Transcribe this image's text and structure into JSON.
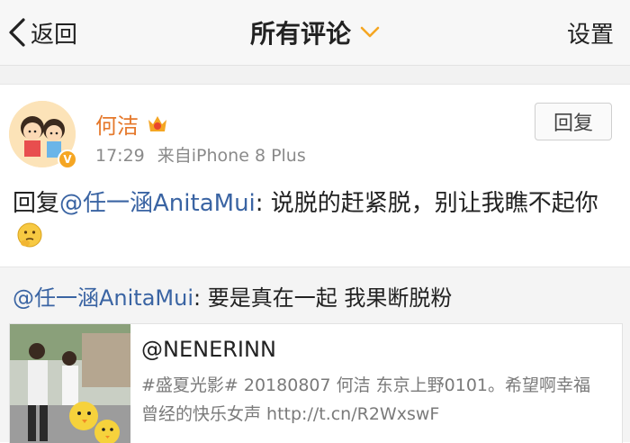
{
  "nav": {
    "back_label": "返回",
    "title": "所有评论",
    "settings_label": "设置",
    "accent_color": "#f5a623"
  },
  "comment": {
    "author": "何洁",
    "author_color": "#e5782b",
    "time": "17:29",
    "source": "来自iPhone 8 Plus",
    "reply_button": "回复",
    "body_prefix": "回复",
    "mention": "@任一涵AnitaMui",
    "body_text": ": 说脱的赶紧脱，别让我瞧不起你",
    "icons": [
      "vip-member-icon",
      "verified-badge-icon",
      "thinking-emoji-icon"
    ]
  },
  "repost": {
    "mention": "@任一涵AnitaMui",
    "text": ": 要是真在一起 我果断脱粉",
    "card": {
      "title": "@NENERINN",
      "description": "#盛夏光影# 20180807 何洁 东京上野0101。希望啊幸福 曾经的快乐女声 http://t.cn/R2WxswF"
    }
  }
}
